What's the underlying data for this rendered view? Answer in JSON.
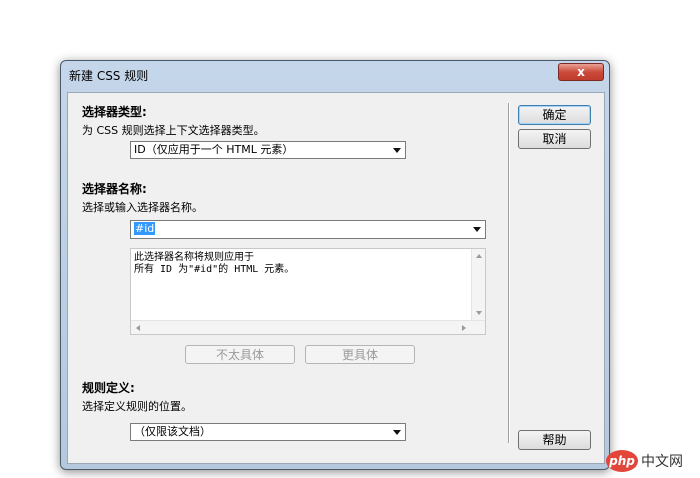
{
  "window": {
    "title": "新建 CSS 规则",
    "close_label": "x"
  },
  "selector_type": {
    "title": "选择器类型:",
    "hint": "为 CSS 规则选择上下文选择器类型。",
    "selected": "ID（仅应用于一个 HTML 元素）"
  },
  "selector_name": {
    "title": "选择器名称:",
    "hint": "选择或输入选择器名称。",
    "value": "#id",
    "description_line1": "此选择器名称将规则应用于",
    "description_line2": "所有 ID 为\"#id\"的 HTML 元素。",
    "less_specific_label": "不太具体",
    "more_specific_label": "更具体"
  },
  "rule_definition": {
    "title": "规则定义:",
    "hint": "选择定义规则的位置。",
    "selected": "（仅限该文档）"
  },
  "buttons": {
    "ok": "确定",
    "cancel": "取消",
    "help": "帮助"
  },
  "watermark": {
    "logo": "php",
    "text": "中文网"
  }
}
